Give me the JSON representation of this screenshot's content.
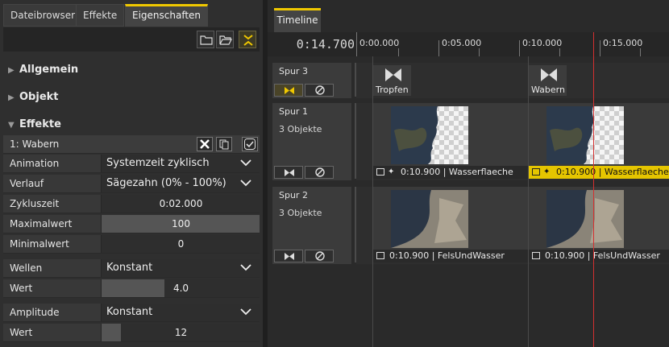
{
  "left_tabs": [
    "Dateibrowser",
    "Effekte",
    "Eigenschaften"
  ],
  "sections": {
    "allgemein": "Allgemein",
    "objekt": "Objekt",
    "effekte": "Effekte"
  },
  "effect_header": "1: Wabern",
  "props": [
    {
      "label": "Animation",
      "value": "Systemzeit zyklisch",
      "type": "dropdown"
    },
    {
      "label": "Verlauf",
      "value": "Sägezahn (0% - 100%)",
      "type": "dropdown"
    },
    {
      "label": "Zykluszeit",
      "value": "0:02.000",
      "type": "number"
    },
    {
      "label": "Maximalwert",
      "value": "100",
      "type": "slider",
      "level": 1.0
    },
    {
      "label": "Minimalwert",
      "value": "0",
      "type": "number"
    },
    {
      "label": "Wellen",
      "value": "Konstant",
      "type": "dropdown"
    },
    {
      "label": "Wert",
      "value": "4.0",
      "type": "slider",
      "level": 0.4
    },
    {
      "label": "Amplitude",
      "value": "Konstant",
      "type": "dropdown"
    },
    {
      "label": "Wert",
      "value": "12",
      "type": "slider",
      "level": 0.12
    }
  ],
  "timeline": {
    "tab": "Timeline",
    "timecode": "0:14.700",
    "ticks": [
      "0:00.000",
      "0:05.000",
      "0:10.000",
      "0:15.000"
    ],
    "tracks": [
      {
        "name": "Spur 3",
        "sub": ""
      },
      {
        "name": "Spur 1",
        "sub": "3 Objekte"
      },
      {
        "name": "Spur 2",
        "sub": "3 Objekte"
      }
    ],
    "markers": [
      "Tropfen",
      "Wabern"
    ],
    "clips_spur1": [
      {
        "time": "0:10.900",
        "name": "Wasserflaeche"
      },
      {
        "time": "0:10.900",
        "name": "Wasserflaeche"
      }
    ],
    "clips_spur2": [
      {
        "time": "0:10.900",
        "name": "FelsUndWasser"
      },
      {
        "time": "0:10.900",
        "name": "FelsUndWasser"
      }
    ]
  },
  "colors": {
    "accent": "#f0c800",
    "playhead": "#d43030"
  }
}
